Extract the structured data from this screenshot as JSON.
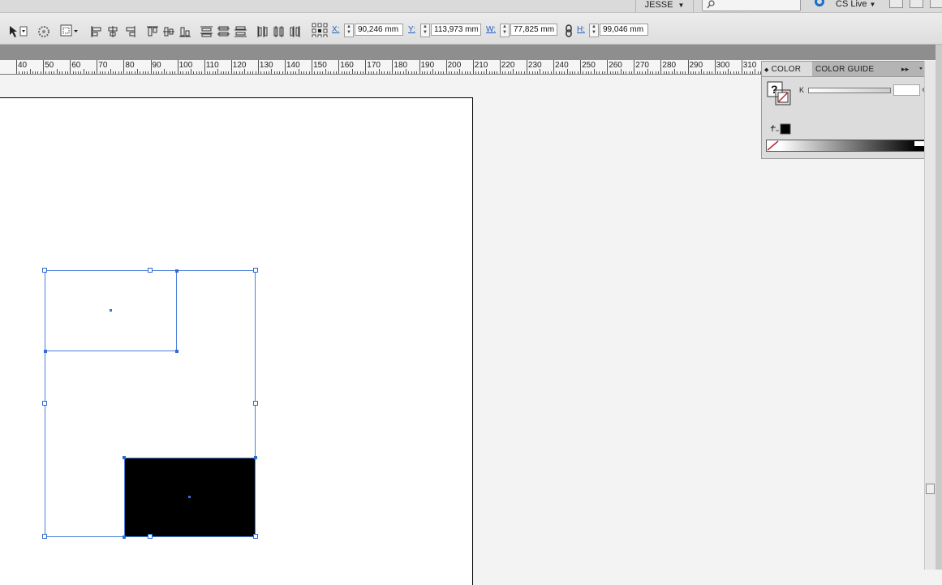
{
  "appbar": {
    "workspace": "JESSE",
    "workspace_arrow": "▼",
    "search_placeholder": "",
    "cslive": "CS Live",
    "cslive_arrow": "▼"
  },
  "control": {
    "x": {
      "label": "X:",
      "value": "90,246 mm"
    },
    "y": {
      "label": "Y:",
      "value": "113,973 mm"
    },
    "w": {
      "label": "W:",
      "value": "77,825 mm"
    },
    "h": {
      "label": "H:",
      "value": "99,046 mm"
    },
    "icons": [
      "selection-tool-icon",
      "refresh-icon",
      "reference-point-icon",
      "align-left-icon",
      "align-center-icon",
      "align-right-icon",
      "align-top-icon",
      "align-middle-icon",
      "align-bottom-icon",
      "distribute-top-icon",
      "distribute-middle-icon",
      "distribute-bottom-icon",
      "distribute-left-icon",
      "distribute-center-icon",
      "distribute-right-icon",
      "reference-grid-icon",
      "constrain-proportions-icon"
    ]
  },
  "ruler": {
    "labels": [
      "40",
      "50",
      "60",
      "70",
      "80",
      "90",
      "100",
      "110",
      "120",
      "130",
      "140",
      "150",
      "160",
      "170",
      "180",
      "190",
      "200",
      "210",
      "220",
      "230",
      "240",
      "250",
      "260",
      "270",
      "280",
      "290",
      "300",
      "310"
    ]
  },
  "color_panel": {
    "tabs": [
      "COLOR",
      "COLOR GUIDE"
    ],
    "active_tab": "COLOR",
    "tab_marker": "◆",
    "menu_glyph": "▸▸",
    "channel_label": "K",
    "channel_value": "",
    "percent_sign": "%",
    "fill_swatch": "black",
    "ramp": "none-white-black"
  },
  "colors": {
    "selection": "#2f6bd1",
    "fill": "#000000",
    "pasteboard": "#f3f3f3",
    "page": "#ffffff"
  }
}
